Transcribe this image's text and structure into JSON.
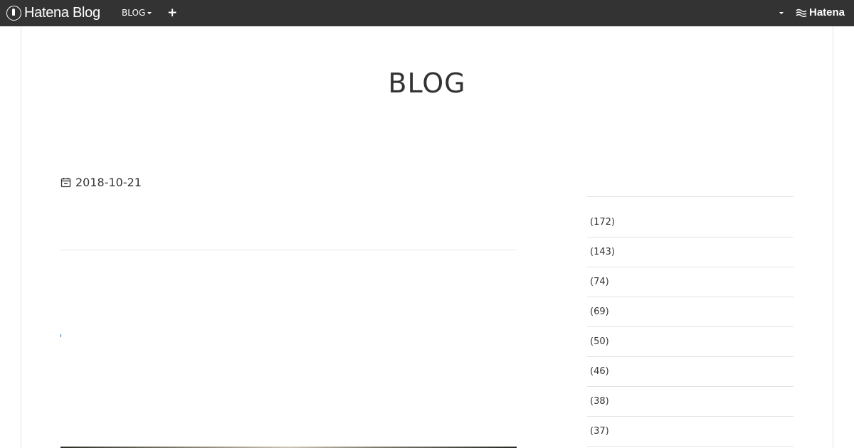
{
  "topbar": {
    "brand": "Hatena Blog",
    "blog_menu_label": "BLOG",
    "add_label": "+",
    "hatena_label": "Hatena"
  },
  "blog": {
    "title": "BLOG"
  },
  "entry": {
    "date": "2018-10-21"
  },
  "sidebar": {
    "categories": [
      {
        "count": "(172)"
      },
      {
        "count": "(143)"
      },
      {
        "count": "(74)"
      },
      {
        "count": "(69)"
      },
      {
        "count": "(50)"
      },
      {
        "count": "(46)"
      },
      {
        "count": "(38)"
      },
      {
        "count": "(37)"
      }
    ]
  },
  "colors": {
    "topbar_bg": "#333333",
    "link": "#2a6db5"
  }
}
